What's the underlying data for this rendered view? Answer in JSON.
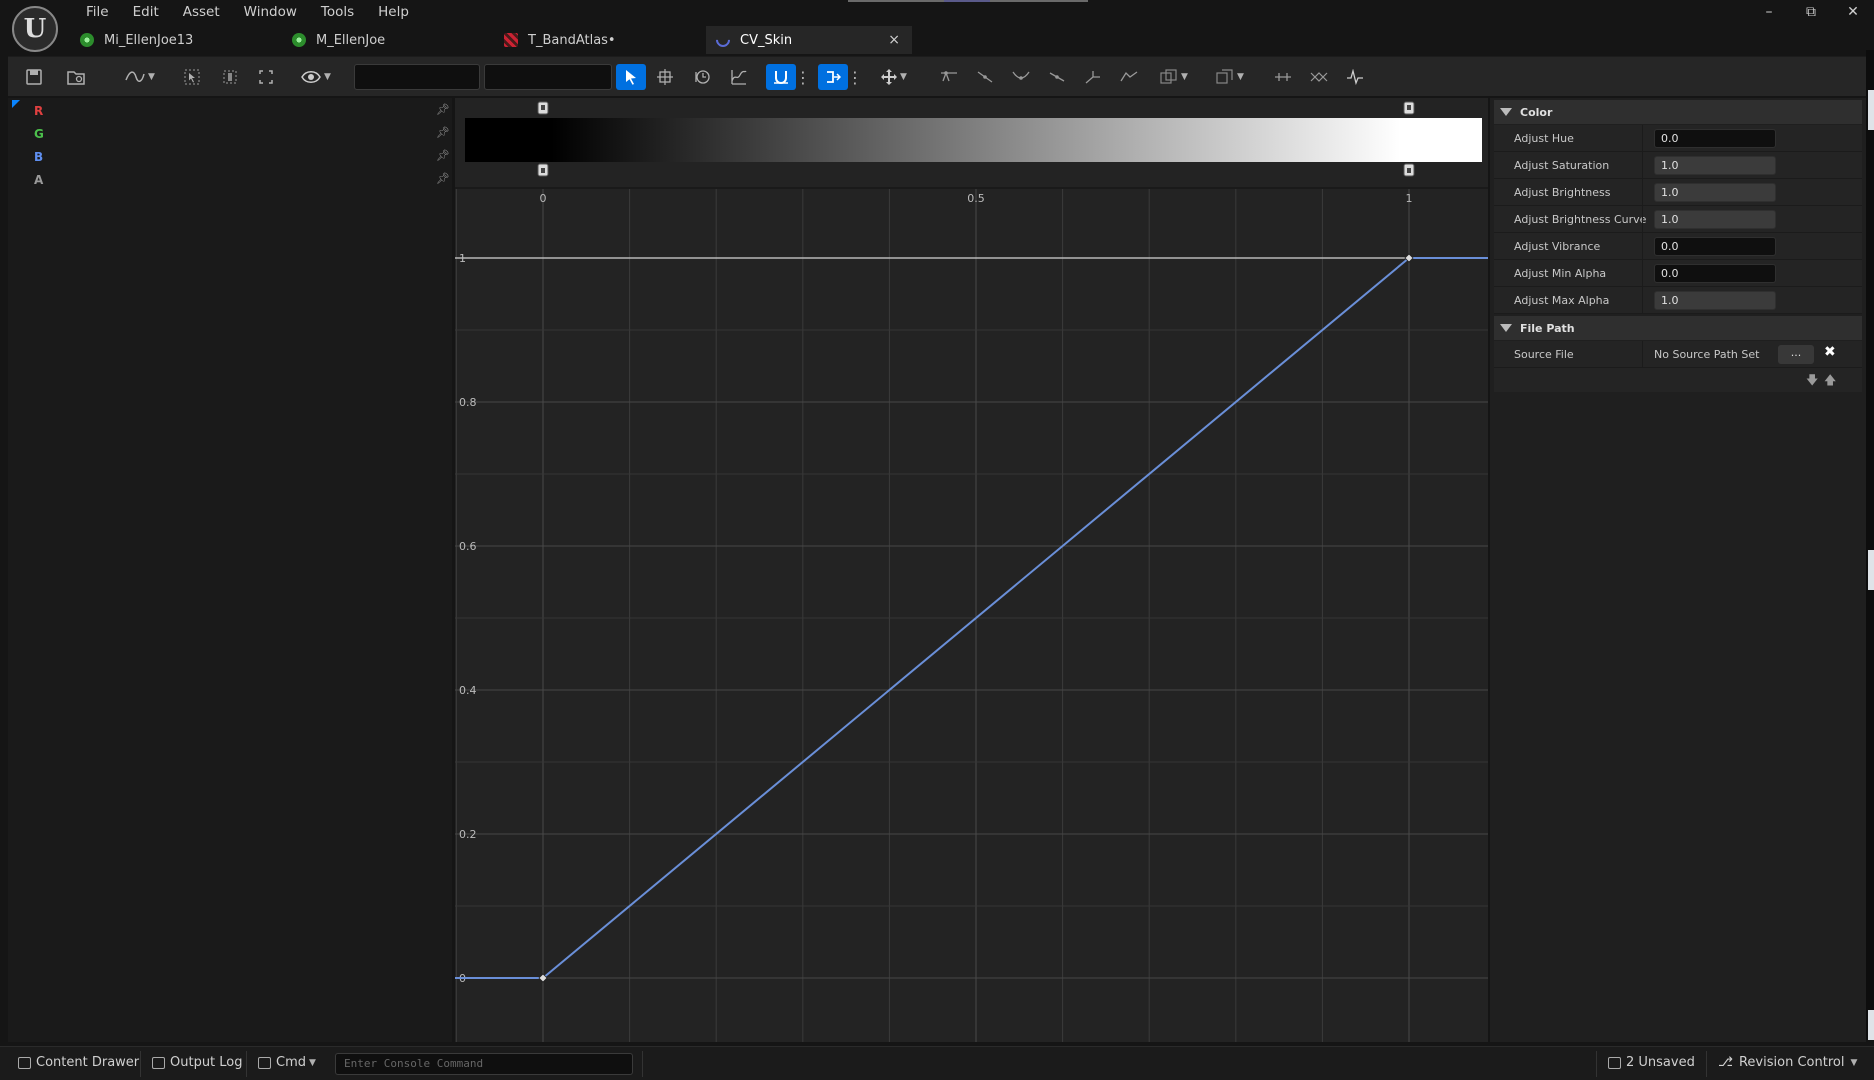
{
  "menu": [
    "File",
    "Edit",
    "Asset",
    "Window",
    "Tools",
    "Help"
  ],
  "tabs": [
    {
      "label": "Mi_EllenJoe13",
      "icon": "material-instance-icon",
      "active": false
    },
    {
      "label": "M_EllenJoe",
      "icon": "material-icon",
      "active": false
    },
    {
      "label": "T_BandAtlas•",
      "icon": "texture-icon",
      "active": false
    },
    {
      "label": "CV_Skin",
      "icon": "curve-asset-icon",
      "active": true
    }
  ],
  "tab_close": "×",
  "window_controls": [
    "–",
    "⧉",
    "✕"
  ],
  "channels": [
    {
      "label": "R",
      "color": "#e04040"
    },
    {
      "label": "G",
      "color": "#4cc04c"
    },
    {
      "label": "B",
      "color": "#5f8ff0"
    },
    {
      "label": "A",
      "color": "#9a9a9a"
    }
  ],
  "graph": {
    "x_ticks": [
      "0",
      "0.5",
      "1"
    ],
    "y_ticks": [
      "1",
      "0.8",
      "0.6",
      "0.4",
      "0.2",
      "0"
    ],
    "curve_color": "#6a8fd8",
    "keys": [
      {
        "x": 0,
        "y": 0
      },
      {
        "x": 1,
        "y": 1
      }
    ]
  },
  "details": {
    "sections": [
      {
        "title": "Color"
      },
      {
        "title": "File Path"
      }
    ],
    "color_props": [
      {
        "label": "Adjust Hue",
        "value": "0.0"
      },
      {
        "label": "Adjust Saturation",
        "value": "1.0"
      },
      {
        "label": "Adjust Brightness",
        "value": "1.0"
      },
      {
        "label": "Adjust Brightness Curve",
        "value": "1.0"
      },
      {
        "label": "Adjust Vibrance",
        "value": "0.0"
      },
      {
        "label": "Adjust Min Alpha",
        "value": "0.0"
      },
      {
        "label": "Adjust Max Alpha",
        "value": "1.0"
      }
    ],
    "source_file_label": "Source File",
    "source_file_value": "No Source Path Set",
    "browse_label": "...",
    "clear_label": "✖"
  },
  "statusbar": {
    "content_drawer": "Content Drawer",
    "output_log": "Output Log",
    "cmd": "Cmd",
    "console_placeholder": "Enter Console Command",
    "unsaved": "2 Unsaved",
    "revision_control": "Revision Control"
  },
  "colors": {
    "accent": "#0070e0",
    "background": "#151515"
  }
}
